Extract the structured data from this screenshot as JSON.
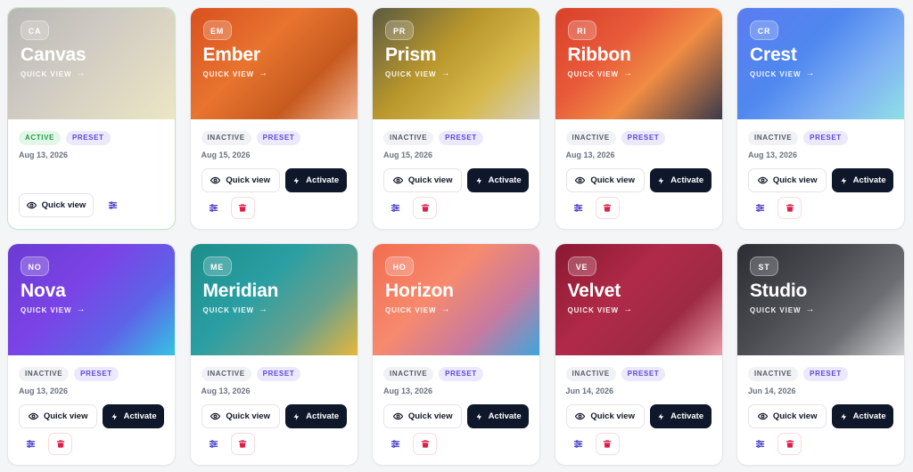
{
  "cards": [
    {
      "abbr": "CA",
      "title": "Canvas",
      "quick_link": "QUICK VIEW",
      "status": "ACTIVE",
      "preset": "PRESET",
      "date": "Aug 13, 2026",
      "quick_view_label": "Quick view",
      "active": true
    },
    {
      "abbr": "EM",
      "title": "Ember",
      "quick_link": "QUICK VIEW",
      "status": "INACTIVE",
      "preset": "PRESET",
      "date": "Aug 15, 2026",
      "quick_view_label": "Quick view",
      "activate_label": "Activate",
      "active": false
    },
    {
      "abbr": "PR",
      "title": "Prism",
      "quick_link": "QUICK VIEW",
      "status": "INACTIVE",
      "preset": "PRESET",
      "date": "Aug 15, 2026",
      "quick_view_label": "Quick view",
      "activate_label": "Activate",
      "active": false
    },
    {
      "abbr": "RI",
      "title": "Ribbon",
      "quick_link": "QUICK VIEW",
      "status": "INACTIVE",
      "preset": "PRESET",
      "date": "Aug 13, 2026",
      "quick_view_label": "Quick view",
      "activate_label": "Activate",
      "active": false
    },
    {
      "abbr": "CR",
      "title": "Crest",
      "quick_link": "QUICK VIEW",
      "status": "INACTIVE",
      "preset": "PRESET",
      "date": "Aug 13, 2026",
      "quick_view_label": "Quick view",
      "activate_label": "Activate",
      "active": false
    },
    {
      "abbr": "NO",
      "title": "Nova",
      "quick_link": "QUICK VIEW",
      "status": "INACTIVE",
      "preset": "PRESET",
      "date": "Aug 13, 2026",
      "quick_view_label": "Quick view",
      "activate_label": "Activate",
      "active": false
    },
    {
      "abbr": "ME",
      "title": "Meridian",
      "quick_link": "QUICK VIEW",
      "status": "INACTIVE",
      "preset": "PRESET",
      "date": "Aug 13, 2026",
      "quick_view_label": "Quick view",
      "activate_label": "Activate",
      "active": false
    },
    {
      "abbr": "HO",
      "title": "Horizon",
      "quick_link": "QUICK VIEW",
      "status": "INACTIVE",
      "preset": "PRESET",
      "date": "Aug 13, 2026",
      "quick_view_label": "Quick view",
      "activate_label": "Activate",
      "active": false
    },
    {
      "abbr": "VE",
      "title": "Velvet",
      "quick_link": "QUICK VIEW",
      "status": "INACTIVE",
      "preset": "PRESET",
      "date": "Jun 14, 2026",
      "quick_view_label": "Quick view",
      "activate_label": "Activate",
      "active": false
    },
    {
      "abbr": "ST",
      "title": "Studio",
      "quick_link": "QUICK VIEW",
      "status": "INACTIVE",
      "preset": "PRESET",
      "date": "Jun 14, 2026",
      "quick_view_label": "Quick view",
      "activate_label": "Activate",
      "active": false
    }
  ],
  "colors": {
    "dark_button": "#0f172a",
    "active_green": "#1f9d45",
    "preset_purple": "#5b47d6",
    "trash_red": "#e11d48",
    "settings_indigo": "#4338ca"
  },
  "icons": [
    "eye-icon",
    "bolt-icon",
    "sliders-icon",
    "trash-icon",
    "arrow-right-icon"
  ]
}
